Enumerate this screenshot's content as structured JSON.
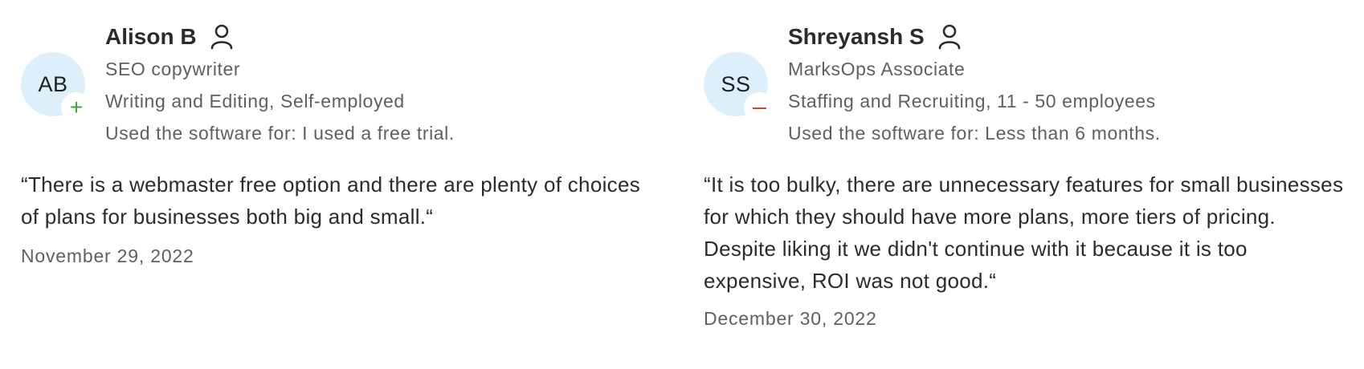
{
  "reviews": [
    {
      "initials": "AB",
      "name": "Alison B",
      "role": "SEO copywriter",
      "industry": "Writing and Editing, Self-employed",
      "usage": "Used the software for: I used a free trial.",
      "sentiment_icon": "plus-icon",
      "sentiment_color": "#3da53d",
      "quote": "“There is a webmaster free option and there are plenty of choices of plans for businesses both big and small.“",
      "date": "November 29, 2022"
    },
    {
      "initials": "SS",
      "name": "Shreyansh S",
      "role": "MarksOps Associate",
      "industry": "Staffing and Recruiting, 11 - 50 employees",
      "usage": "Used the software for: Less than 6 months.",
      "sentiment_icon": "minus-icon",
      "sentiment_color": "#d8403a",
      "quote": "“It is too bulky, there are unnecessary features for small businesses for which they should have more plans, more tiers of pricing. Despite liking it we didn't continue with it because it is too expensive, ROI was not good.“",
      "date": "December 30, 2022"
    }
  ],
  "colors": {
    "avatar_bg": "#ddeffa",
    "text_primary": "#2b2b2b",
    "text_secondary": "#5f5f5f"
  }
}
